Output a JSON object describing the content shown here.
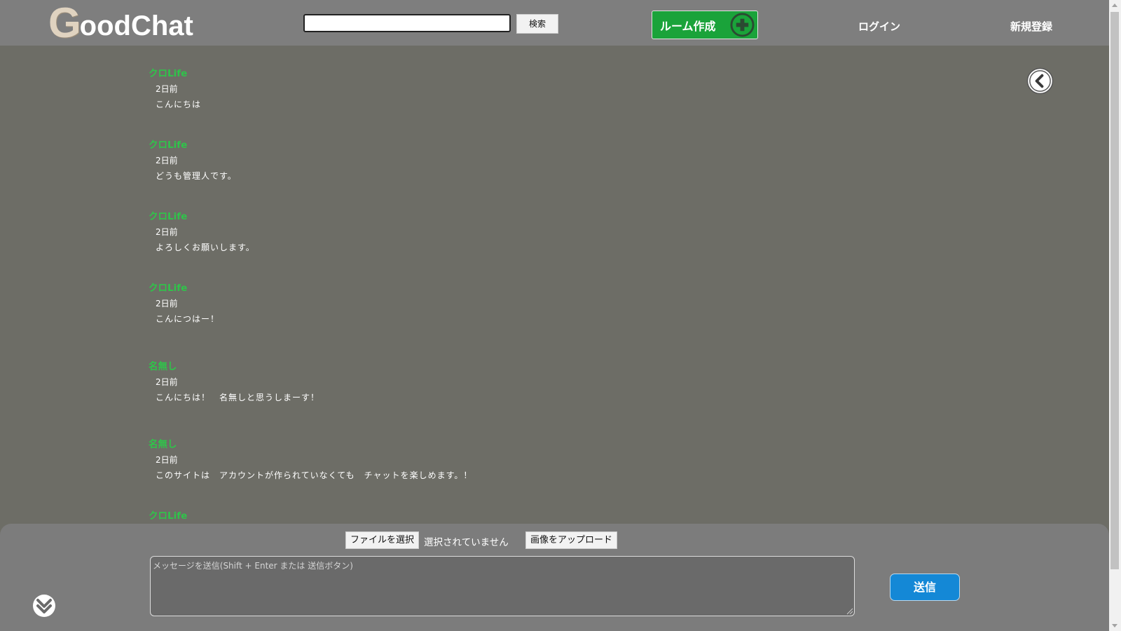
{
  "header": {
    "logo_first": "G",
    "logo_rest": "oodChat",
    "search_placeholder": "",
    "search_button": "検索",
    "create_room": "ルーム作成",
    "login": "ログイン",
    "signup": "新規登録"
  },
  "messages": [
    {
      "user": "クロLife",
      "time": "2日前",
      "text": "こんにちは"
    },
    {
      "user": "クロLife",
      "time": "2日前",
      "text": "どうも管理人です。"
    },
    {
      "user": "クロLife",
      "time": "2日前",
      "text": "よろしくお願いします。"
    },
    {
      "user": "クロLife",
      "time": "2日前",
      "text": "こんにつはー！"
    },
    {
      "user": "名無し",
      "time": "2日前",
      "text": "こんにちは！　名無しと思うしまーす！"
    },
    {
      "user": "名無し",
      "time": "2日前",
      "text": "このサイトは　アカウントが作られていなくても　チャットを楽しめます。！"
    },
    {
      "user": "クロLife",
      "time": "",
      "text": ""
    }
  ],
  "composer": {
    "file_button": "ファイルを選択",
    "file_status": "選択されていません",
    "upload_button": "画像をアップロード",
    "message_placeholder": "メッセージを送信(Shift + Enter または 送信ボタン)",
    "send_button": "送信"
  },
  "colors": {
    "background": "#6d6d66",
    "header": "#7e7e7e",
    "username": "#2fc44a",
    "create_room": "#1aa33a",
    "send": "#1488d6"
  },
  "icons": {
    "create_room": "plus-circle-icon",
    "back": "chevron-left-circle-icon",
    "scroll_down": "double-chevron-down-icon"
  }
}
